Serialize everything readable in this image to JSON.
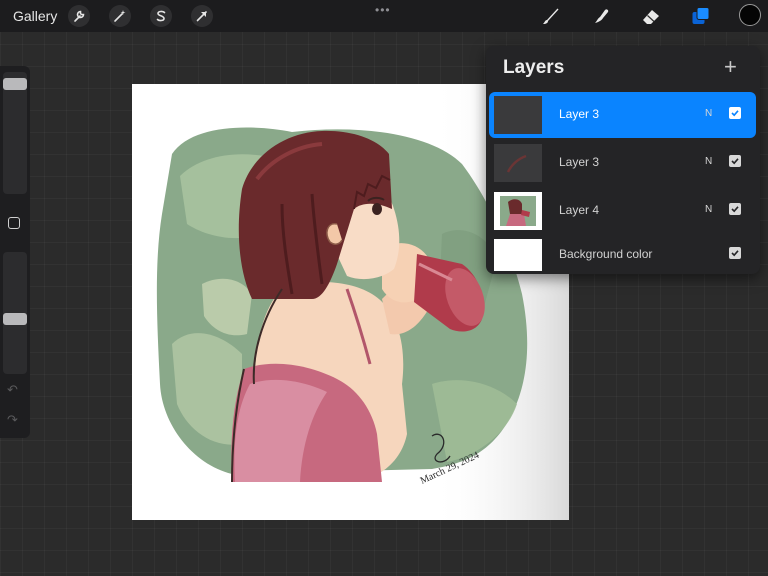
{
  "topbar": {
    "gallery_label": "Gallery",
    "left_tools": [
      "wrench-icon",
      "magic-wand-icon",
      "selection-icon",
      "transform-arrow-icon"
    ],
    "more_label": "•••",
    "right_tools": [
      "brush-icon",
      "smudge-icon",
      "eraser-icon",
      "layers-icon"
    ],
    "current_color": "#050505",
    "accent_color": "#0a84ff"
  },
  "sidebar": {
    "brush_size_level": 0.95,
    "opacity_level": 0.45,
    "undo_icon": "undo-icon",
    "redo_icon": "redo-icon"
  },
  "layers_panel": {
    "title": "Layers",
    "add_label": "+",
    "layers": [
      {
        "name": "Layer 3",
        "blend": "N",
        "visible": true,
        "active": true
      },
      {
        "name": "Layer 3",
        "blend": "N",
        "visible": true,
        "active": false
      },
      {
        "name": "Layer 4",
        "blend": "N",
        "visible": true,
        "active": false
      },
      {
        "name": "Background color",
        "blend": "",
        "visible": true,
        "active": false
      }
    ]
  },
  "canvas": {
    "signature_text": "March 29, 2024"
  }
}
